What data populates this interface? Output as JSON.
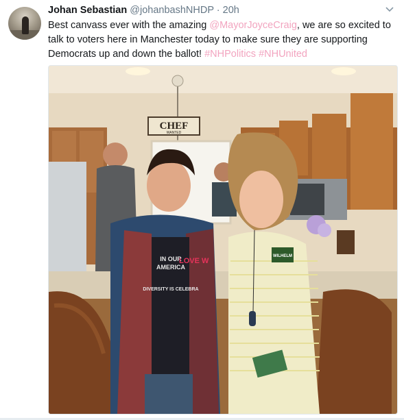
{
  "tweet": {
    "author_name": "Johan Sebastian",
    "author_handle": "@johanbashNHDP",
    "separator": "·",
    "timestamp": "20h",
    "text_part1": "Best canvass ever with the amazing ",
    "mention": "@MayorJoyceCraig",
    "text_part2": ", we are so excited to talk to voters here in Manchester today to make sure they are supporting Democrats up and down the ballot! ",
    "hashtag1": "#NHPolitics",
    "hashtag2": "#NHUnited"
  },
  "photo": {
    "sign_main": "CHEF",
    "sign_sub": "WANTED",
    "shirt_line1": "IN OUR",
    "shirt_line2": "AMERICA",
    "shirt_line3": "LOVE W",
    "shirt_line4": "DIVERSITY IS CELEBRA",
    "sticker_text": "WILHELM"
  },
  "colors": {
    "link": "#f2a4bf",
    "name": "#14171a",
    "meta": "#657786"
  },
  "icons": {
    "caret": "chevron-down-icon"
  }
}
